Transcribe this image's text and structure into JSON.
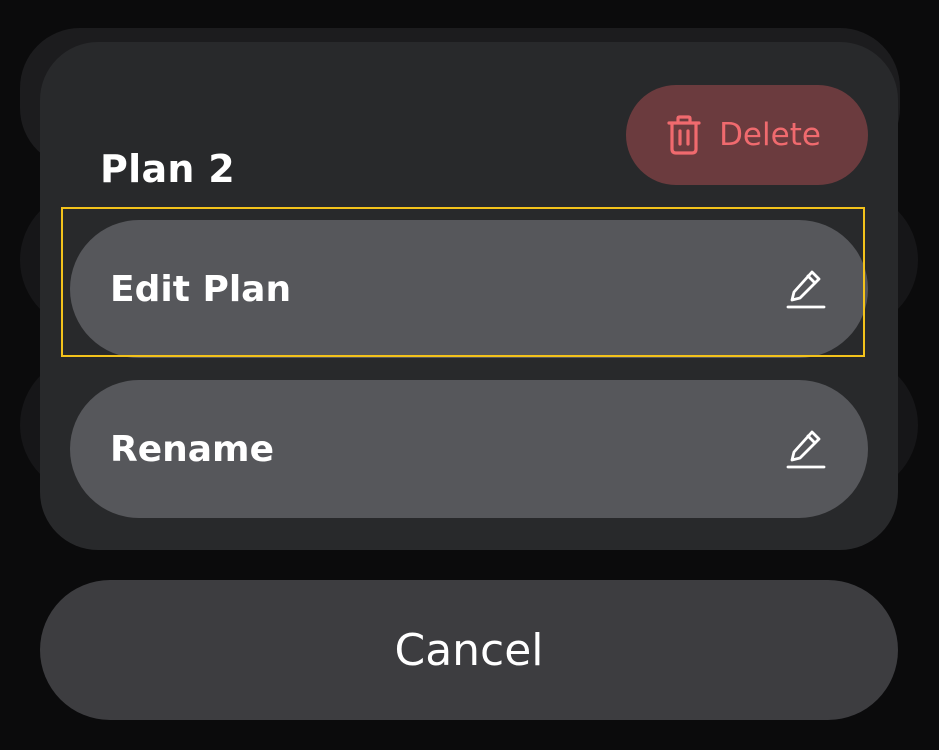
{
  "sheet": {
    "title": "Plan 2",
    "delete_label": "Delete",
    "delete_icon": "trash-icon",
    "options": [
      {
        "label": "Edit Plan",
        "icon": "pencil-icon"
      },
      {
        "label": "Rename",
        "icon": "pencil-icon"
      }
    ]
  },
  "cancel_label": "Cancel",
  "colors": {
    "sheet_bg": "#28292b",
    "option_bg": "#56575b",
    "delete_bg": "#6b3b3e",
    "delete_fg": "#f06a6e",
    "cancel_bg": "#3d3d40",
    "highlight": "#f3c21b"
  }
}
